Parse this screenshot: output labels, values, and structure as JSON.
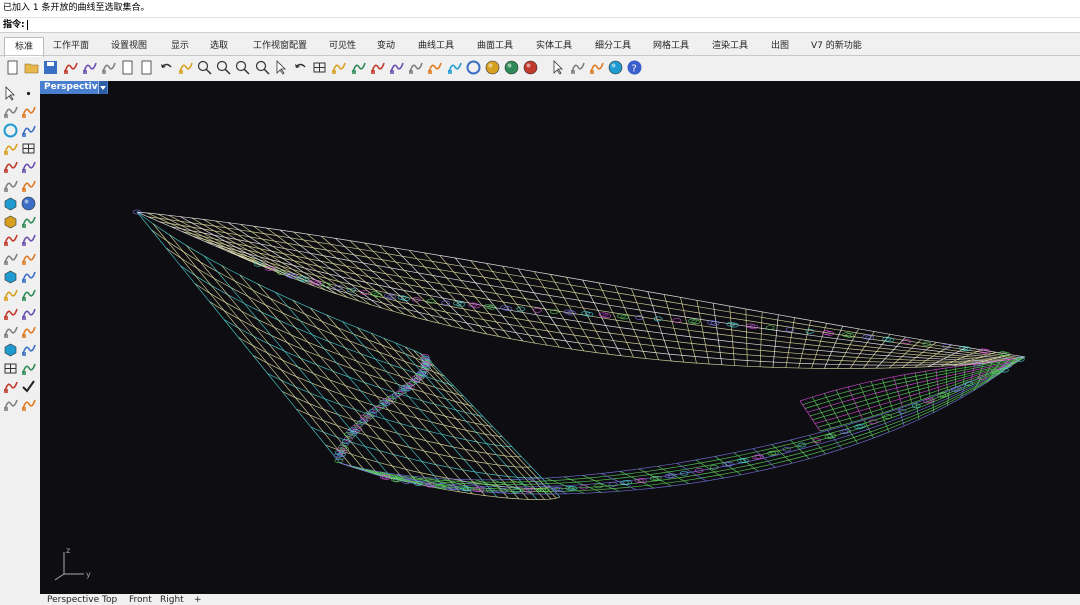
{
  "history": {
    "message": "已加入 1 条开放的曲线至选取集合。"
  },
  "command": {
    "prompt": "指令:"
  },
  "tabs": [
    {
      "label": "标准",
      "active": true
    },
    {
      "label": "工作平面"
    },
    {
      "label": "设置视图"
    },
    {
      "label": "显示"
    },
    {
      "label": "选取"
    },
    {
      "label": "工作视窗配置"
    },
    {
      "label": "可见性"
    },
    {
      "label": "变动"
    },
    {
      "label": "曲线工具"
    },
    {
      "label": "曲面工具"
    },
    {
      "label": "实体工具"
    },
    {
      "label": "细分工具"
    },
    {
      "label": "网格工具"
    },
    {
      "label": "渲染工具"
    },
    {
      "label": "出图"
    },
    {
      "label": "V7 的新功能"
    }
  ],
  "toolbar": {
    "icons": [
      "new-document-icon",
      "open-folder-icon",
      "save-icon",
      "print-icon",
      "import-icon",
      "cut-icon",
      "copy-icon",
      "paste-icon",
      "undo-icon",
      "pan-hand-icon",
      "rotate-view-icon",
      "zoom-icon",
      "zoom-window-icon",
      "zoom-extents-icon",
      "zoom-selected-icon",
      "undo-view-icon",
      "four-viewports-icon",
      "cplane-icon",
      "camera-icon",
      "display-mode-icon",
      "layer-icon",
      "light-icon",
      "lock-icon",
      "properties-icon",
      "color-wheel-icon",
      "material-sphere-icon",
      "render-sphere-icon",
      "environment-sphere-icon",
      "arrow-select-icon",
      "settings-gear-icon",
      "grasshopper-icon",
      "network-globe-icon",
      "help-icon"
    ]
  },
  "sidebar": {
    "icons": [
      "select-arrow-icon",
      "point-icon",
      "polyline-icon",
      "curve-edit-icon",
      "circle-icon",
      "arc-icon",
      "polygon-icon",
      "rectangle-icon",
      "ellipse-icon",
      "freeform-curve-icon",
      "fillet-icon",
      "rotate-icon",
      "box-icon",
      "sphere-icon",
      "cylinder-icon",
      "extrude-icon",
      "boolean-icon",
      "paint-icon",
      "trim-icon",
      "split-icon",
      "mesh-icon",
      "group-icon",
      "fillet-edge-icon",
      "rebuild-icon",
      "text-icon",
      "dimension-icon",
      "block-icon",
      "array-icon",
      "solid-tools-icon",
      "history-icon",
      "grid-array-icon",
      "move-icon",
      "analyze-icon",
      "check-icon",
      "render-icon",
      "transform-icon"
    ]
  },
  "viewport": {
    "title": "Perspective",
    "background": "#0e0e12",
    "axis": {
      "z": "z",
      "y": "y"
    },
    "grid_colors": [
      "#e8e6a8",
      "#ffffff",
      "#5fd65f",
      "#d84fd8",
      "#4fd8d8",
      "#7878e8"
    ]
  },
  "viewport_tabs": [
    "Perspective",
    "Top",
    "Front",
    "Right",
    "+"
  ]
}
